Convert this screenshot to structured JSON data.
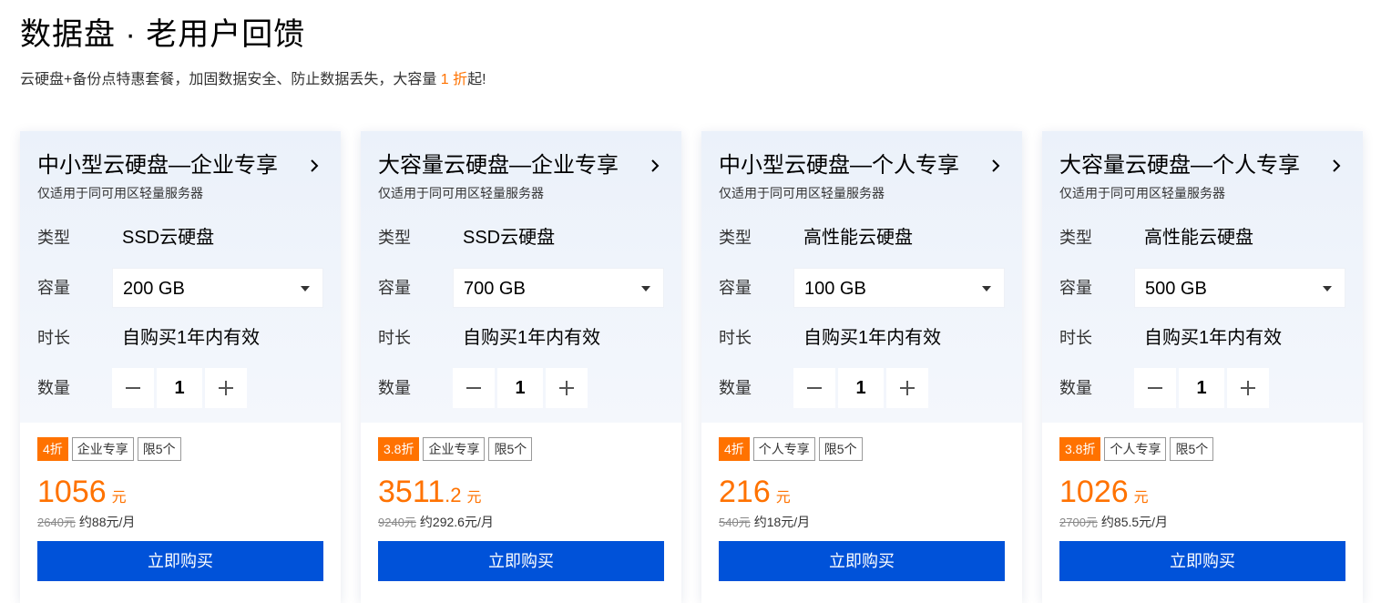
{
  "header": {
    "title": "数据盘 · 老用户回馈",
    "subtitle_prefix": "云硬盘+备份点特惠套餐，加固数据安全、防止数据丢失，大容量 ",
    "subtitle_highlight": "1 折",
    "subtitle_suffix": "起!"
  },
  "labels": {
    "type": "类型",
    "capacity": "容量",
    "duration": "时长",
    "quantity": "数量"
  },
  "colors": {
    "accent_orange": "#ff7200",
    "button_blue": "#0052d9"
  },
  "cards": [
    {
      "title": "中小型云硬盘—企业专享",
      "desc": "仅适用于同可用区轻量服务器",
      "type_value": "SSD云硬盘",
      "capacity_value": "200 GB",
      "duration_value": "自购买1年内有效",
      "quantity": "1",
      "tags": {
        "discount": "4折",
        "audience": "企业专享",
        "limit": "限5个"
      },
      "price_int": "1056",
      "price_dec": "",
      "price_unit": "元",
      "original_price": "2640元",
      "monthly": "约88元/月",
      "buy_label": "立即购买"
    },
    {
      "title": "大容量云硬盘—企业专享",
      "desc": "仅适用于同可用区轻量服务器",
      "type_value": "SSD云硬盘",
      "capacity_value": "700 GB",
      "duration_value": "自购买1年内有效",
      "quantity": "1",
      "tags": {
        "discount": "3.8折",
        "audience": "企业专享",
        "limit": "限5个"
      },
      "price_int": "3511",
      "price_dec": ".2",
      "price_unit": "元",
      "original_price": "9240元",
      "monthly": "约292.6元/月",
      "buy_label": "立即购买"
    },
    {
      "title": "中小型云硬盘—个人专享",
      "desc": "仅适用于同可用区轻量服务器",
      "type_value": "高性能云硬盘",
      "capacity_value": "100 GB",
      "duration_value": "自购买1年内有效",
      "quantity": "1",
      "tags": {
        "discount": "4折",
        "audience": "个人专享",
        "limit": "限5个"
      },
      "price_int": "216",
      "price_dec": "",
      "price_unit": "元",
      "original_price": "540元",
      "monthly": "约18元/月",
      "buy_label": "立即购买"
    },
    {
      "title": "大容量云硬盘—个人专享",
      "desc": "仅适用于同可用区轻量服务器",
      "type_value": "高性能云硬盘",
      "capacity_value": "500 GB",
      "duration_value": "自购买1年内有效",
      "quantity": "1",
      "tags": {
        "discount": "3.8折",
        "audience": "个人专享",
        "limit": "限5个"
      },
      "price_int": "1026",
      "price_dec": "",
      "price_unit": "元",
      "original_price": "2700元",
      "monthly": "约85.5元/月",
      "buy_label": "立即购买"
    }
  ]
}
